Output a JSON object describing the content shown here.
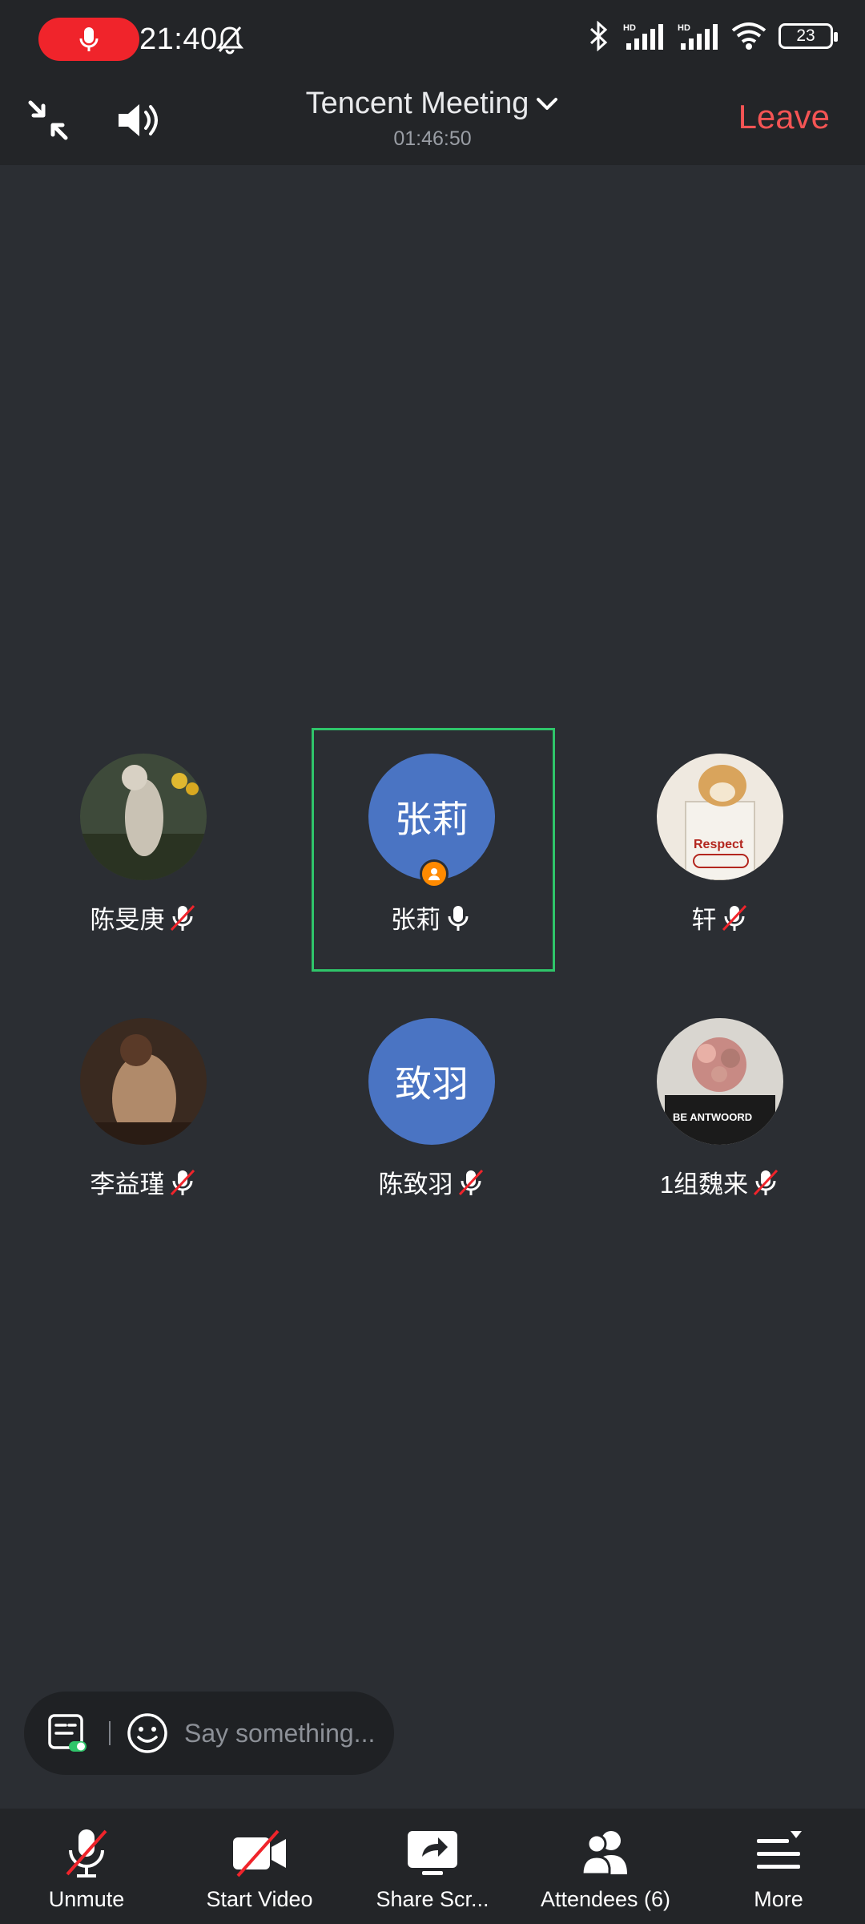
{
  "status_bar": {
    "time": "21:40",
    "battery": "23"
  },
  "header": {
    "title": "Tencent Meeting",
    "timer": "01:46:50",
    "leave_label": "Leave"
  },
  "participants": [
    {
      "name": "陈旻庚",
      "avatar_type": "photo",
      "mic": "muted"
    },
    {
      "name": "张莉",
      "avatar_type": "text",
      "avatar_text": "张莉",
      "mic": "on",
      "speaking": true,
      "host": true
    },
    {
      "name": "轩",
      "avatar_type": "photo",
      "mic": "muted"
    },
    {
      "name": "李益瑾",
      "avatar_type": "photo",
      "mic": "muted"
    },
    {
      "name": "陈致羽",
      "avatar_type": "text",
      "avatar_text": "致羽",
      "mic": "muted"
    },
    {
      "name": "1组魏来",
      "avatar_type": "photo",
      "mic": "muted"
    }
  ],
  "chat": {
    "placeholder": "Say something..."
  },
  "toolbar": {
    "unmute_label": "Unmute",
    "start_video_label": "Start Video",
    "share_label": "Share Scr...",
    "attendees_label": "Attendees (6)",
    "more_label": "More"
  },
  "colors": {
    "background": "#2b2e33",
    "bar": "#232528",
    "leave": "#f45454",
    "recording": "#f0242b",
    "active_speaker": "#2fc56a",
    "avatar_blue": "#4a74c3",
    "host_badge": "#ff8a00"
  }
}
